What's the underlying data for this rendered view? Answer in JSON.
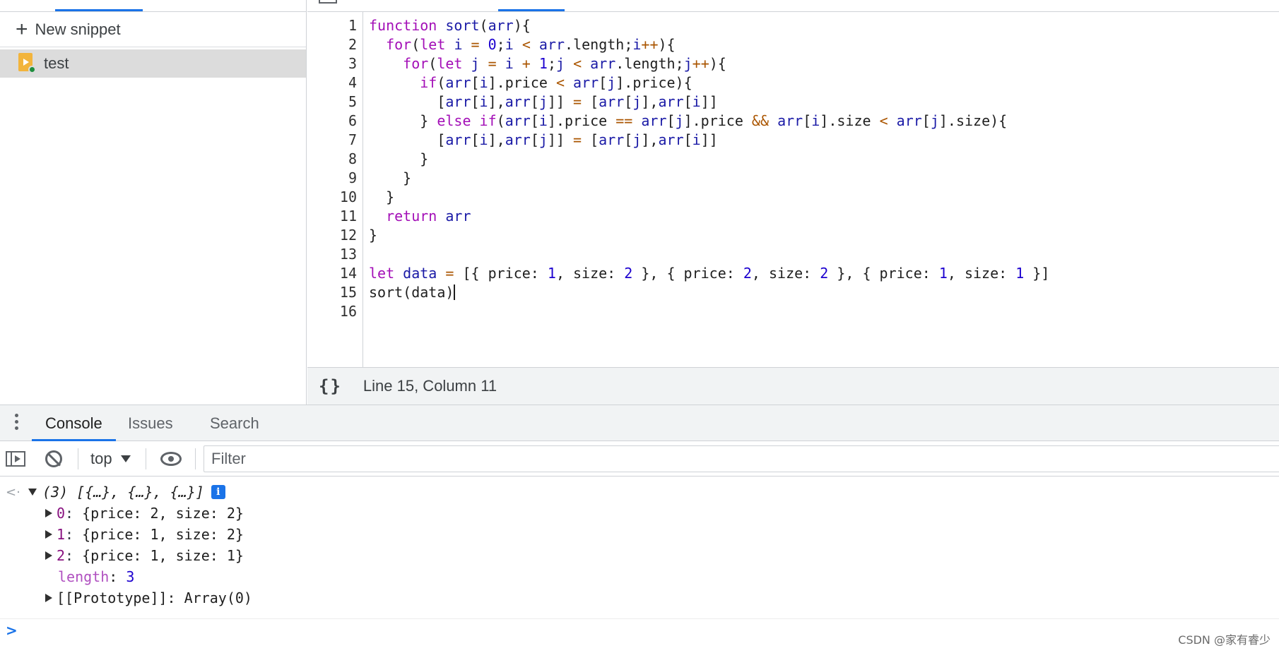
{
  "sources": {
    "new_snippet_label": "New snippet",
    "snippets": [
      {
        "label": "test",
        "icon": "snippet-file-icon"
      }
    ]
  },
  "editor": {
    "lines": [
      [
        [
          "kw",
          "function"
        ],
        [
          "plain",
          " "
        ],
        [
          "var",
          "sort"
        ],
        [
          "plain",
          "("
        ],
        [
          "var",
          "arr"
        ],
        [
          "plain",
          "){"
        ]
      ],
      [
        [
          "plain",
          "  "
        ],
        [
          "kw",
          "for"
        ],
        [
          "plain",
          "("
        ],
        [
          "kw",
          "let"
        ],
        [
          "plain",
          " "
        ],
        [
          "var",
          "i"
        ],
        [
          "plain",
          " "
        ],
        [
          "op",
          "="
        ],
        [
          "plain",
          " "
        ],
        [
          "num",
          "0"
        ],
        [
          "plain",
          ";"
        ],
        [
          "var",
          "i"
        ],
        [
          "plain",
          " "
        ],
        [
          "op",
          "<"
        ],
        [
          "plain",
          " "
        ],
        [
          "var",
          "arr"
        ],
        [
          "plain",
          ".length;"
        ],
        [
          "var",
          "i"
        ],
        [
          "op",
          "++"
        ],
        [
          "plain",
          "){"
        ]
      ],
      [
        [
          "plain",
          "    "
        ],
        [
          "kw",
          "for"
        ],
        [
          "plain",
          "("
        ],
        [
          "kw",
          "let"
        ],
        [
          "plain",
          " "
        ],
        [
          "var",
          "j"
        ],
        [
          "plain",
          " "
        ],
        [
          "op",
          "="
        ],
        [
          "plain",
          " "
        ],
        [
          "var",
          "i"
        ],
        [
          "plain",
          " "
        ],
        [
          "op",
          "+"
        ],
        [
          "plain",
          " "
        ],
        [
          "num",
          "1"
        ],
        [
          "plain",
          ";"
        ],
        [
          "var",
          "j"
        ],
        [
          "plain",
          " "
        ],
        [
          "op",
          "<"
        ],
        [
          "plain",
          " "
        ],
        [
          "var",
          "arr"
        ],
        [
          "plain",
          ".length;"
        ],
        [
          "var",
          "j"
        ],
        [
          "op",
          "++"
        ],
        [
          "plain",
          "){"
        ]
      ],
      [
        [
          "plain",
          "      "
        ],
        [
          "kw",
          "if"
        ],
        [
          "plain",
          "("
        ],
        [
          "var",
          "arr"
        ],
        [
          "plain",
          "["
        ],
        [
          "var",
          "i"
        ],
        [
          "plain",
          "].price "
        ],
        [
          "op",
          "<"
        ],
        [
          "plain",
          " "
        ],
        [
          "var",
          "arr"
        ],
        [
          "plain",
          "["
        ],
        [
          "var",
          "j"
        ],
        [
          "plain",
          "].price){"
        ]
      ],
      [
        [
          "plain",
          "        ["
        ],
        [
          "var",
          "arr"
        ],
        [
          "plain",
          "["
        ],
        [
          "var",
          "i"
        ],
        [
          "plain",
          "],"
        ],
        [
          "var",
          "arr"
        ],
        [
          "plain",
          "["
        ],
        [
          "var",
          "j"
        ],
        [
          "plain",
          "]] "
        ],
        [
          "op",
          "="
        ],
        [
          "plain",
          " ["
        ],
        [
          "var",
          "arr"
        ],
        [
          "plain",
          "["
        ],
        [
          "var",
          "j"
        ],
        [
          "plain",
          "],"
        ],
        [
          "var",
          "arr"
        ],
        [
          "plain",
          "["
        ],
        [
          "var",
          "i"
        ],
        [
          "plain",
          "]]"
        ]
      ],
      [
        [
          "plain",
          "      } "
        ],
        [
          "kw",
          "else"
        ],
        [
          "plain",
          " "
        ],
        [
          "kw",
          "if"
        ],
        [
          "plain",
          "("
        ],
        [
          "var",
          "arr"
        ],
        [
          "plain",
          "["
        ],
        [
          "var",
          "i"
        ],
        [
          "plain",
          "].price "
        ],
        [
          "op",
          "=="
        ],
        [
          "plain",
          " "
        ],
        [
          "var",
          "arr"
        ],
        [
          "plain",
          "["
        ],
        [
          "var",
          "j"
        ],
        [
          "plain",
          "].price "
        ],
        [
          "op",
          "&&"
        ],
        [
          "plain",
          " "
        ],
        [
          "var",
          "arr"
        ],
        [
          "plain",
          "["
        ],
        [
          "var",
          "i"
        ],
        [
          "plain",
          "].size "
        ],
        [
          "op",
          "<"
        ],
        [
          "plain",
          " "
        ],
        [
          "var",
          "arr"
        ],
        [
          "plain",
          "["
        ],
        [
          "var",
          "j"
        ],
        [
          "plain",
          "].size){"
        ]
      ],
      [
        [
          "plain",
          "        ["
        ],
        [
          "var",
          "arr"
        ],
        [
          "plain",
          "["
        ],
        [
          "var",
          "i"
        ],
        [
          "plain",
          "],"
        ],
        [
          "var",
          "arr"
        ],
        [
          "plain",
          "["
        ],
        [
          "var",
          "j"
        ],
        [
          "plain",
          "]] "
        ],
        [
          "op",
          "="
        ],
        [
          "plain",
          " ["
        ],
        [
          "var",
          "arr"
        ],
        [
          "plain",
          "["
        ],
        [
          "var",
          "j"
        ],
        [
          "plain",
          "],"
        ],
        [
          "var",
          "arr"
        ],
        [
          "plain",
          "["
        ],
        [
          "var",
          "i"
        ],
        [
          "plain",
          "]]"
        ]
      ],
      [
        [
          "plain",
          "      }"
        ]
      ],
      [
        [
          "plain",
          "    }"
        ]
      ],
      [
        [
          "plain",
          "  }"
        ]
      ],
      [
        [
          "plain",
          "  "
        ],
        [
          "kw",
          "return"
        ],
        [
          "plain",
          " "
        ],
        [
          "var",
          "arr"
        ]
      ],
      [
        [
          "plain",
          "}"
        ]
      ],
      [],
      [
        [
          "kw",
          "let"
        ],
        [
          "plain",
          " "
        ],
        [
          "var",
          "data"
        ],
        [
          "plain",
          " "
        ],
        [
          "op",
          "="
        ],
        [
          "plain",
          " [{ price: "
        ],
        [
          "num",
          "1"
        ],
        [
          "plain",
          ", size: "
        ],
        [
          "num",
          "2"
        ],
        [
          "plain",
          " }, { price: "
        ],
        [
          "num",
          "2"
        ],
        [
          "plain",
          ", size: "
        ],
        [
          "num",
          "2"
        ],
        [
          "plain",
          " }, { price: "
        ],
        [
          "num",
          "1"
        ],
        [
          "plain",
          ", size: "
        ],
        [
          "num",
          "1"
        ],
        [
          "plain",
          " }]"
        ]
      ],
      [
        [
          "plain",
          "sort(data)"
        ]
      ],
      []
    ],
    "cursor_line": 15,
    "status": {
      "pretty_print_label": "{}",
      "position": "Line 15, Column 11"
    }
  },
  "drawer": {
    "tabs": [
      {
        "label": "Console",
        "active": true
      },
      {
        "label": "Issues",
        "active": false
      },
      {
        "label": "Search",
        "active": false
      }
    ]
  },
  "console": {
    "context": "top",
    "filter_placeholder": "Filter",
    "result": {
      "summary": "(3) [{…}, {…}, {…}]",
      "info_icon": "i",
      "entries": [
        {
          "index": "0",
          "value": "{price: 2, size: 2}"
        },
        {
          "index": "1",
          "value": "{price: 1, size: 2}"
        },
        {
          "index": "2",
          "value": "{price: 1, size: 1}"
        }
      ],
      "length_key": "length",
      "length_value": "3",
      "prototype": "[[Prototype]]: Array(0)"
    }
  },
  "watermark": "CSDN @家有睿少",
  "colors": {
    "accent": "#1a73e8",
    "keyword": "#a30fb7",
    "variable": "#1a1aa6",
    "number": "#1c00cf",
    "operator": "#aa5500",
    "selected_row": "#dcdcdc"
  }
}
